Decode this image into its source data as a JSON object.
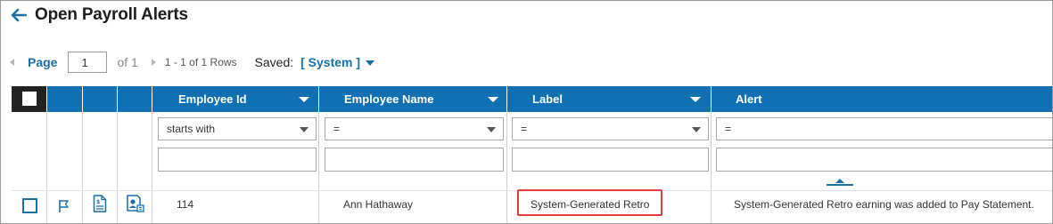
{
  "page": {
    "title": "Open Payroll Alerts"
  },
  "pager": {
    "page_label": "Page",
    "page_value": "1",
    "of_text": "of 1",
    "rows_text": "1 - 1 of 1 Rows",
    "saved_label": "Saved:",
    "saved_value": "[ System ]"
  },
  "table": {
    "columns": [
      {
        "label": "Employee Id",
        "filter_operator": "starts with",
        "filter_value": ""
      },
      {
        "label": "Employee Name",
        "filter_operator": "=",
        "filter_value": ""
      },
      {
        "label": "Label",
        "filter_operator": "=",
        "filter_value": ""
      },
      {
        "label": "Alert",
        "filter_operator": "=",
        "filter_value": ""
      }
    ],
    "rows": [
      {
        "employee_id": "114",
        "employee_name": "Ann Hathaway",
        "label": "System-Generated Retro",
        "alert": "System-Generated Retro earning was added to Pay Statement."
      }
    ]
  },
  "icons": {
    "back": "arrow-left-icon",
    "row_flag": "flag-icon",
    "row_statement": "pay-statement-icon",
    "row_employee": "employee-card-icon",
    "sort": "sort-up-icon"
  },
  "colors": {
    "header_blue": "#1170b4",
    "link_blue": "#1a6fa8",
    "highlight_red": "#e0393e"
  }
}
